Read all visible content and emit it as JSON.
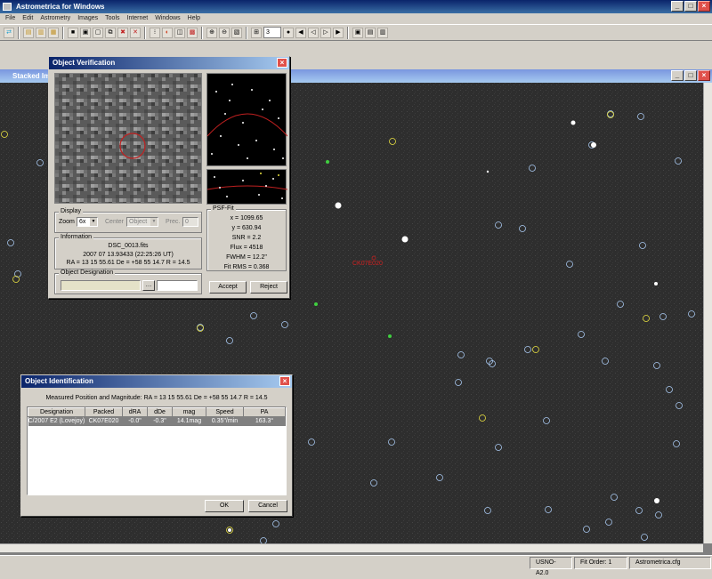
{
  "app": {
    "title": "Astrometrica for Windows",
    "menu": [
      "File",
      "Edit",
      "Astrometry",
      "Images",
      "Tools",
      "Internet",
      "Windows",
      "Help"
    ],
    "toolbar_spin_value": "3"
  },
  "stacked_window": {
    "title": "Stacked Im"
  },
  "object_verification": {
    "title": "Object Verification",
    "display": {
      "group_label": "Display",
      "zoom_label": "Zoom",
      "zoom_value": "6x",
      "center_label": "Center",
      "center_value": "Object",
      "prec_label": "Prec.",
      "prec_value": "0"
    },
    "information": {
      "group_label": "Information",
      "file": "DSC_0013.fits",
      "date": "2007 07 13.93433 (22:25:26 UT)",
      "coords": "RA = 13 15 55.61   De = +58 55 14.7   R = 14.5"
    },
    "designation": {
      "group_label": "Object Designation",
      "value": "",
      "value2": ""
    },
    "psf": {
      "group_label": "PSF-Fit",
      "lines": [
        "x = 1099.65",
        "y = 630.94",
        "SNR = 2.2",
        "Flux = 4518",
        "FWHM = 12.2\"",
        "Fit RMS = 0.368"
      ]
    },
    "accept_label": "Accept",
    "reject_label": "Reject"
  },
  "object_identification": {
    "title": "Object Identification",
    "summary": "Measured Position and Magnitude:  RA = 13 15 55.61   De = +58 55 14.7   R = 14.5",
    "columns": [
      "Designation",
      "Packed",
      "dRA",
      "dDe",
      "mag",
      "Speed",
      "PA"
    ],
    "rows": [
      [
        "C/2007 E2 (Lovejoy)",
        "CK07E020",
        "-0.0\"",
        "-0.3\"",
        "14.1mag",
        "0.35\"/min",
        "163.3°"
      ]
    ],
    "ok_label": "OK",
    "cancel_label": "Cancel"
  },
  "status_bar": {
    "catalog": "USNO-A2.0",
    "fit_order": "Fit Order: 1",
    "config": "Astrometrica.cfg"
  },
  "colors": {
    "stars_circle": "#a8c8f0",
    "known_object": "#e8e040",
    "target": "#d02020"
  }
}
